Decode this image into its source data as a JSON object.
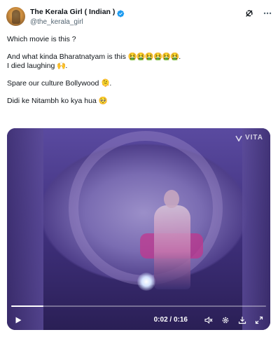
{
  "author": {
    "display_name": "The Kerala Girl ( Indian )",
    "handle": "@the_kerala_girl"
  },
  "icons": {
    "verified": "verified-badge-icon",
    "grok": "grok-icon",
    "more": "more-options-icon"
  },
  "tweet": {
    "line1": "Which movie is this ?",
    "line2_text": "And what kinda Bharatnatyam is this ",
    "line2_emoji": "🤮🤮🤮🤮🤮🤮",
    "line2_end": ".",
    "line3_text": "I died laughing ",
    "line3_emoji": "🙌",
    "line3_end": ".",
    "line4_text": "Spare our culture Bollywood ",
    "line4_emoji": "🫠",
    "line4_end": ".",
    "line5_text": "Didi ke Nitambh ko kya hua ",
    "line5_emoji": "🥺"
  },
  "video": {
    "watermark": "VITA",
    "time": "0:02 / 0:16",
    "progress": 0.125
  },
  "colors": {
    "verified_blue": "#1d9bf0",
    "text": "#0f1419",
    "muted": "#536471"
  }
}
